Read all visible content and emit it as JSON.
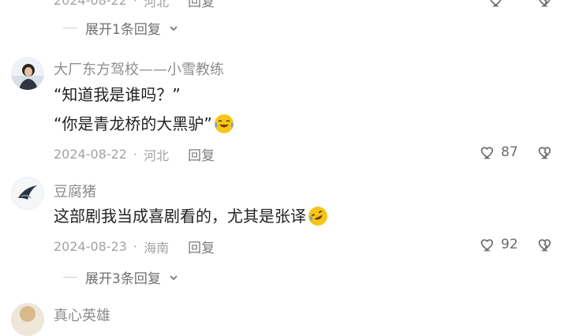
{
  "top": {
    "date": "2024-08-22",
    "location": "河北",
    "reply_label": "回复",
    "expand_label": "展开1条回复"
  },
  "comments": [
    {
      "username": "大厂东方驾校——小雪教练",
      "line1": "“知道我是谁吗？”",
      "line2": "“你是青龙桥的大黑驴”",
      "emoji": "crying-laughing-emoji",
      "date": "2024-08-22",
      "location": "河北",
      "reply_label": "回复",
      "likes": "87"
    },
    {
      "username": "豆腐猪",
      "line1": "这部剧我当成喜剧看的，尤其是张译",
      "emoji": "rolling-laughing-emoji",
      "date": "2024-08-23",
      "location": "海南",
      "reply_label": "回复",
      "likes": "92",
      "expand_label": "展开3条回复"
    },
    {
      "username": "真心英雄"
    }
  ],
  "icons": {
    "like": "heart-icon",
    "dislike": "broken-heart-icon",
    "chevron": "chevron-down-icon"
  },
  "colors": {
    "accent_emoji": "#f5c518",
    "tear": "#4aa3ff"
  }
}
